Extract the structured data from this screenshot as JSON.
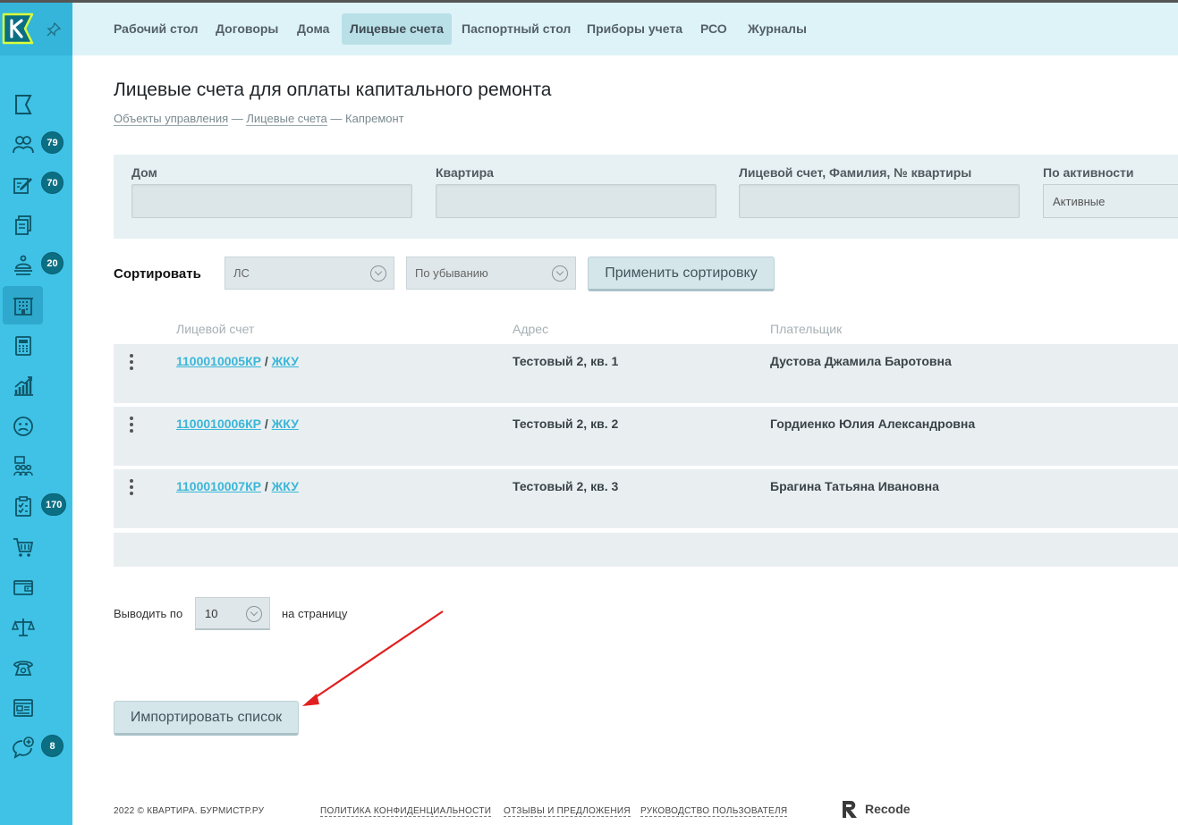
{
  "sidebar": {
    "badges": {
      "residents": "79",
      "requests": "70",
      "duty": "20",
      "tasks": "170",
      "chat": "8"
    },
    "icons": [
      "flag-icon",
      "residents-icon",
      "edit-icon",
      "documents-icon",
      "duty-icon",
      "building-icon",
      "calculator-icon",
      "analytics-icon",
      "sad-face-icon",
      "staff-icon",
      "checklist-icon",
      "cart-icon",
      "wallet-icon",
      "scales-icon",
      "phone-icon",
      "news-icon",
      "chat-add-icon"
    ]
  },
  "nav": {
    "items": [
      "Рабочий стол",
      "Договоры",
      "Дома",
      "Лицевые счета",
      "Паспортный стол",
      "Приборы учета",
      "РСО",
      "Журналы"
    ],
    "active": "Лицевые счета"
  },
  "page": {
    "title": "Лицевые счета для оплаты капитального ремонта",
    "breadcrumb": {
      "item1": "Объекты управления",
      "item2": "Лицевые счета",
      "current": "Капремонт",
      "sep": "—"
    }
  },
  "filters": {
    "house_label": "Дом",
    "apartment_label": "Квартира",
    "account_label": "Лицевой счет, Фамилия, № квартиры",
    "activity_label": "По активности",
    "activity_value": "Активные"
  },
  "sort": {
    "label": "Сортировать",
    "field_value": "ЛС",
    "order_value": "По убыванию",
    "apply_label": "Применить сортировку"
  },
  "table": {
    "headers": [
      "Лицевой счет",
      "Адрес",
      "Плательщик"
    ],
    "rows": [
      {
        "account": "1100010005КР",
        "link2": "ЖКУ",
        "sep": " / ",
        "address": "Тестовый 2, кв. 1",
        "payer": "Дустова Джамила Баротовна"
      },
      {
        "account": "1100010006КР",
        "link2": "ЖКУ",
        "sep": " / ",
        "address": "Тестовый 2, кв. 2",
        "payer": "Гордиенко Юлия Александровна"
      },
      {
        "account": "1100010007КР",
        "link2": "ЖКУ",
        "sep": " / ",
        "address": "Тестовый 2, кв. 3",
        "payer": "Брагина Татьяна Ивановна"
      }
    ]
  },
  "pagination": {
    "prefix": "Выводить по",
    "value": "10",
    "suffix": "на страницу"
  },
  "import_label": "Импортировать список",
  "footer": {
    "copyright": "2022 © КВАРТИРА. БУРМИСТР.РУ",
    "privacy": "ПОЛИТИКА КОНФИДЕНЦИАЛЬНОСТИ",
    "feedback": "ОТЗЫВЫ И ПРЕДЛОЖЕНИЯ",
    "manual": "РУКОВОДСТВО ПОЛЬЗОВАТЕЛЯ",
    "brand": "Recode"
  },
  "colors": {
    "sidebar": "#3fc2e6",
    "topnav": "#ddf3f8",
    "link": "#3bb6d8",
    "badge": "#0b6f83",
    "annotation_arrow": "#e02020"
  }
}
